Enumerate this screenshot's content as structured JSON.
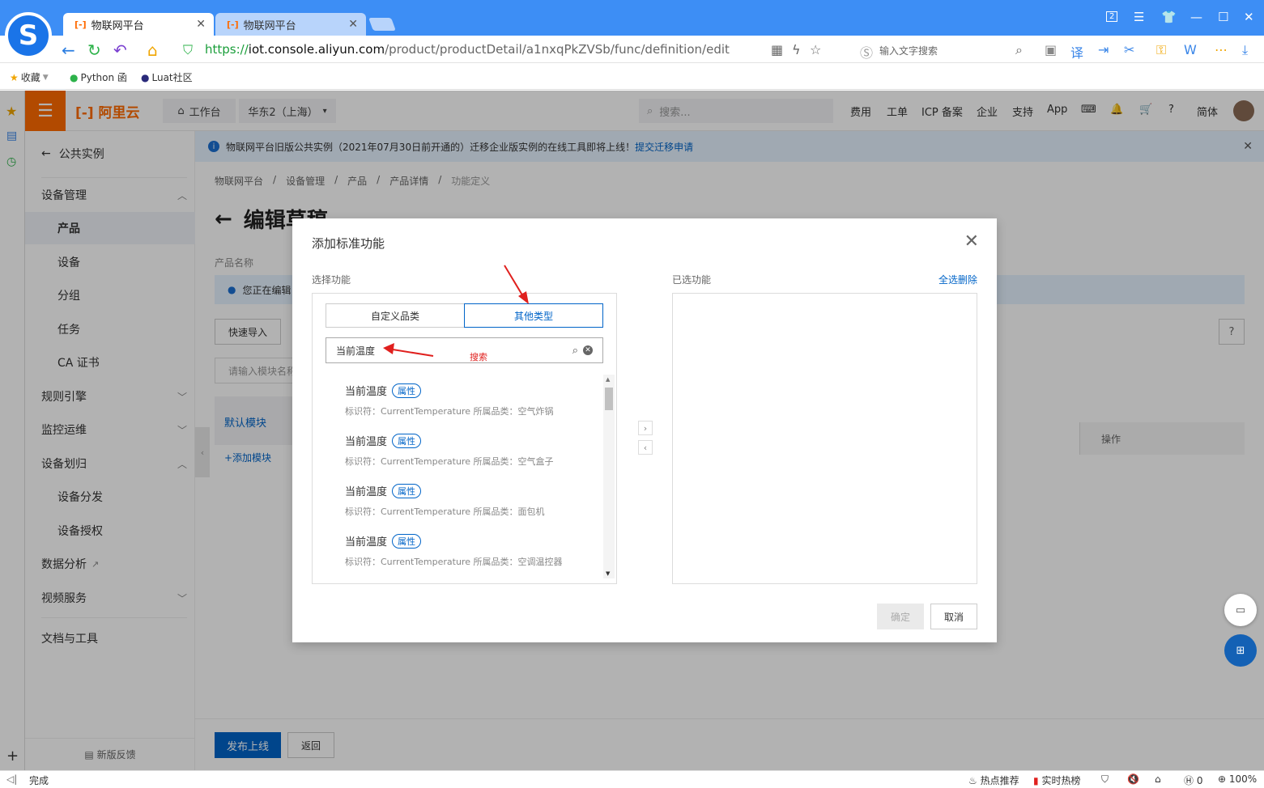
{
  "browser": {
    "tabs": [
      {
        "icon": "[-]",
        "title": "物联网平台",
        "close": "✕"
      },
      {
        "icon": "[-]",
        "title": "物联网平台",
        "close": "✕"
      }
    ],
    "url": {
      "proto": "https://",
      "host": "iot.console.aliyun.com",
      "path": "/product/productDetail/a1nxqPkZVSb/func/definition/edit"
    },
    "search_placeholder": "输入文字搜索",
    "bookmarks": [
      "收藏",
      "Python 函",
      "Luat社区"
    ],
    "badge": "2"
  },
  "topnav": {
    "brand": "阿里云",
    "workbench": "工作台",
    "region": "华东2（上海）",
    "search": "搜索...",
    "links": [
      "费用",
      "工单",
      "ICP 备案",
      "企业",
      "支持",
      "App"
    ],
    "lang": "简体"
  },
  "sidebar": {
    "back": "公共实例",
    "items": [
      "设备管理",
      "产品",
      "设备",
      "分组",
      "任务",
      "CA 证书",
      "规则引擎",
      "监控运维",
      "设备划归",
      "设备分发",
      "设备授权",
      "数据分析",
      "视频服务",
      "文档与工具"
    ],
    "feedback": "新版反馈"
  },
  "notice": {
    "text": "物联网平台旧版公共实例（2021年07月30日前开通的）迁移企业版实例的在线工具即将上线！",
    "link": "提交迁移申请"
  },
  "page": {
    "breadcrumb": [
      "物联网平台",
      "设备管理",
      "产品",
      "产品详情",
      "功能定义"
    ],
    "title": "编辑草稿",
    "product_label": "产品名称",
    "editing": "您正在编辑",
    "quick_import": "快速导入",
    "module_search": "请输入模块名称",
    "default_module": "默认模块",
    "add_module": "+添加模块",
    "op_header": "操作",
    "publish": "发布上线",
    "back": "返回"
  },
  "modal": {
    "title": "添加标准功能",
    "select_label": "选择功能",
    "selected_label": "已选功能",
    "select_all_delete": "全选删除",
    "tab_custom": "自定义品类",
    "tab_other": "其他类型",
    "search_value": "当前温度",
    "annotation": "搜索",
    "items": [
      {
        "name": "当前温度",
        "tag": "属性",
        "meta": "标识符：CurrentTemperature   所属品类：空气炸锅"
      },
      {
        "name": "当前温度",
        "tag": "属性",
        "meta": "标识符：CurrentTemperature   所属品类：空气盒子"
      },
      {
        "name": "当前温度",
        "tag": "属性",
        "meta": "标识符：CurrentTemperature   所属品类：面包机"
      },
      {
        "name": "当前温度",
        "tag": "属性",
        "meta": "标识符：CurrentTemperature   所属品类：空调温控器"
      }
    ],
    "ok": "确定",
    "cancel": "取消"
  },
  "status": {
    "left": "完成",
    "hot": "热点推荐",
    "rank": "实时热榜",
    "count": "0",
    "zoom": "100%"
  }
}
